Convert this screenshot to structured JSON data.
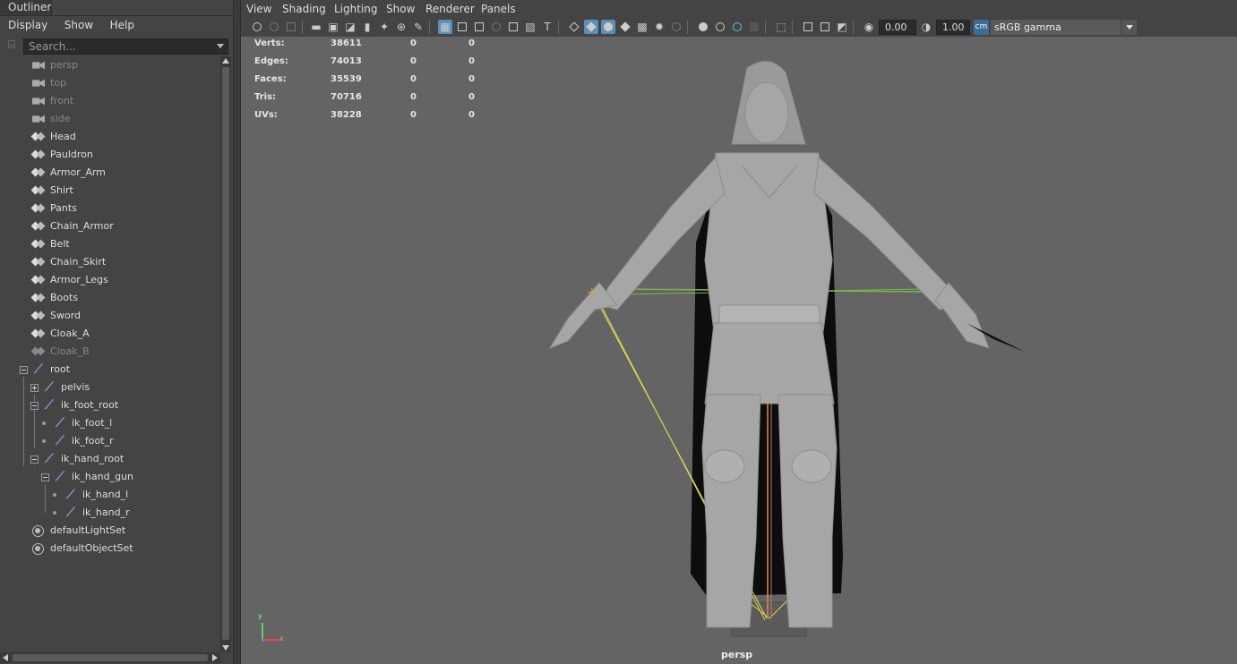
{
  "outliner": {
    "title": "Outliner",
    "menu": [
      "Display",
      "Show",
      "Help"
    ],
    "search_placeholder": "Search...",
    "items": [
      {
        "label": "persp",
        "type": "camera",
        "dim": true
      },
      {
        "label": "top",
        "type": "camera",
        "dim": true
      },
      {
        "label": "front",
        "type": "camera",
        "dim": true
      },
      {
        "label": "side",
        "type": "camera",
        "dim": true
      },
      {
        "label": "Head",
        "type": "mesh"
      },
      {
        "label": "Pauldron",
        "type": "mesh"
      },
      {
        "label": "Armor_Arm",
        "type": "mesh"
      },
      {
        "label": "Shirt",
        "type": "mesh"
      },
      {
        "label": "Pants",
        "type": "mesh"
      },
      {
        "label": "Chain_Armor",
        "type": "mesh"
      },
      {
        "label": "Belt",
        "type": "mesh"
      },
      {
        "label": "Chain_Skirt",
        "type": "mesh"
      },
      {
        "label": "Armor_Legs",
        "type": "mesh"
      },
      {
        "label": "Boots",
        "type": "mesh"
      },
      {
        "label": "Sword",
        "type": "mesh"
      },
      {
        "label": "Cloak_A",
        "type": "mesh"
      },
      {
        "label": "Cloak_B",
        "type": "mesh",
        "dim": true
      },
      {
        "label": "root",
        "type": "joint"
      },
      {
        "label": "pelvis",
        "type": "joint"
      },
      {
        "label": "ik_foot_root",
        "type": "joint"
      },
      {
        "label": "ik_foot_l",
        "type": "joint"
      },
      {
        "label": "ik_foot_r",
        "type": "joint"
      },
      {
        "label": "ik_hand_root",
        "type": "joint"
      },
      {
        "label": "ik_hand_gun",
        "type": "joint"
      },
      {
        "label": "ik_hand_l",
        "type": "joint"
      },
      {
        "label": "ik_hand_r",
        "type": "joint"
      },
      {
        "label": "defaultLightSet",
        "type": "set"
      },
      {
        "label": "defaultObjectSet",
        "type": "set"
      }
    ]
  },
  "viewport": {
    "menu": [
      "View",
      "Shading",
      "Lighting",
      "Show",
      "Renderer",
      "Panels"
    ],
    "exposure": "0.00",
    "gamma": "1.00",
    "color_space": "sRGB gamma",
    "camera": "persp",
    "hud": [
      {
        "label": "Verts:",
        "v1": "38611",
        "v2": "0",
        "v3": "0"
      },
      {
        "label": "Edges:",
        "v1": "74013",
        "v2": "0",
        "v3": "0"
      },
      {
        "label": "Faces:",
        "v1": "35539",
        "v2": "0",
        "v3": "0"
      },
      {
        "label": "Tris:",
        "v1": "70716",
        "v2": "0",
        "v3": "0"
      },
      {
        "label": "UVs:",
        "v1": "38228",
        "v2": "0",
        "v3": "0"
      }
    ],
    "axis": {
      "y": "y",
      "x": "x"
    }
  },
  "colors": {
    "panel_bg": "#444444",
    "viewport_bg": "#646464",
    "active_blue": "#5d8fb7",
    "joint_purple": "#9b8fd6"
  }
}
